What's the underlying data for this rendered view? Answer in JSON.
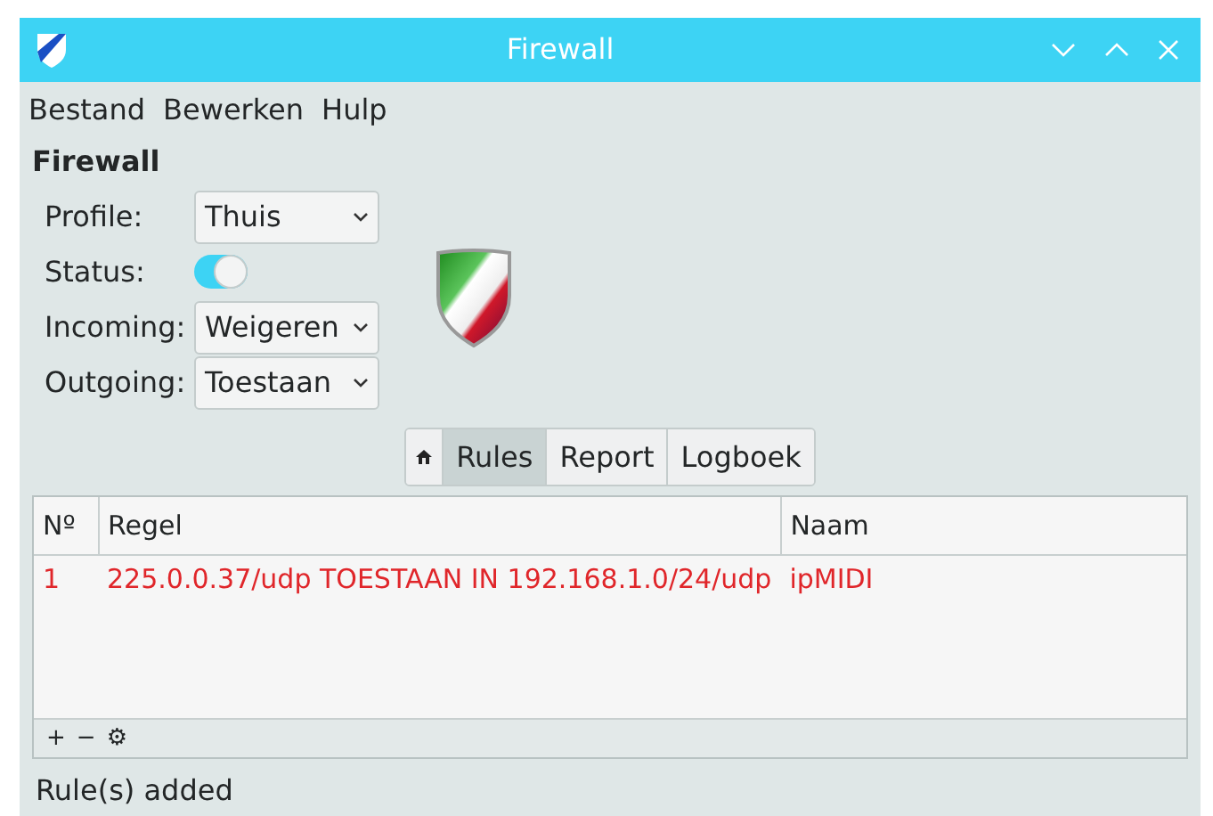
{
  "window": {
    "title": "Firewall"
  },
  "menu": [
    "Bestand",
    "Bewerken",
    "Hulp"
  ],
  "section_title": "Firewall",
  "settings": [
    {
      "kind": "select",
      "label": "Profile:",
      "value": "Thuis"
    },
    {
      "kind": "toggle",
      "label": "Status:",
      "on": true
    },
    {
      "kind": "select",
      "label": "Incoming:",
      "value": "Weigeren"
    },
    {
      "kind": "select",
      "label": "Outgoing:",
      "value": "Toestaan"
    }
  ],
  "tabs": [
    {
      "kind": "home",
      "selected": false
    },
    {
      "kind": "text",
      "label": "Rules",
      "selected": true
    },
    {
      "kind": "text",
      "label": "Report",
      "selected": false
    },
    {
      "kind": "text",
      "label": "Logboek",
      "selected": false
    }
  ],
  "table": {
    "columns": [
      "Nº",
      "Regel",
      "Naam"
    ],
    "rows": [
      {
        "cells": [
          "1",
          "225.0.0.37/udp TOESTAAN IN 192.168.1.0/24/udp",
          "ipMIDI"
        ],
        "color": "#e0262a"
      }
    ]
  },
  "toolbar": [
    "+",
    "−",
    "⚙"
  ],
  "status_bar": "Rule(s) added"
}
